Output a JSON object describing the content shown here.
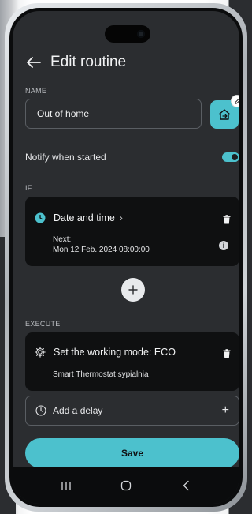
{
  "header": {
    "title": "Edit routine"
  },
  "name_section": {
    "label": "NAME",
    "value": "Out of home"
  },
  "notify": {
    "label": "Notify when started",
    "enabled": true
  },
  "if_section": {
    "label": "IF",
    "trigger_title": "Date and time",
    "next_label": "Next:",
    "next_value": "Mon 12 Feb. 2024 08:00:00"
  },
  "execute_section": {
    "label": "EXECUTE",
    "action_title": "Set the working mode: ECO",
    "action_device": "Smart Thermostat sypialnia"
  },
  "delay": {
    "label": "Add a delay"
  },
  "save": {
    "label": "Save"
  },
  "colors": {
    "accent": "#4cc1cd",
    "background": "#2b2d30",
    "card": "#0f1011"
  },
  "icons": [
    "back-arrow-icon",
    "home-exit-icon",
    "pencil-icon",
    "clock-icon",
    "trash-icon",
    "info-icon",
    "plus-icon",
    "gear-icon",
    "clock-outline-icon",
    "recents-icon",
    "home-nav-icon",
    "back-nav-icon"
  ]
}
